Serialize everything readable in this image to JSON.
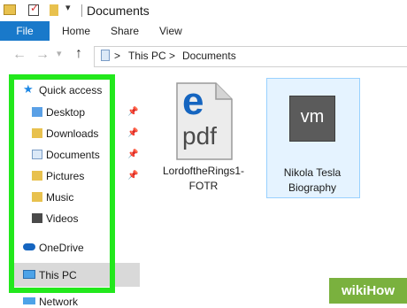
{
  "window": {
    "title": "Documents"
  },
  "ribbon": {
    "tabs": [
      "File",
      "Home",
      "Share",
      "View"
    ]
  },
  "address": {
    "segments": [
      "This PC",
      "Documents"
    ],
    "separator": ">"
  },
  "sidebar": {
    "quick_access": "Quick access",
    "items": [
      {
        "label": "Desktop",
        "pinned": true
      },
      {
        "label": "Downloads",
        "pinned": true
      },
      {
        "label": "Documents",
        "pinned": true
      },
      {
        "label": "Pictures",
        "pinned": true
      },
      {
        "label": "Music",
        "pinned": false
      },
      {
        "label": "Videos",
        "pinned": false
      }
    ],
    "onedrive": "OneDrive",
    "this_pc": "This PC",
    "network": "Network"
  },
  "files": [
    {
      "name_line1": "LordoftheRings1-",
      "name_line2": "FOTR",
      "icon_letter": "e",
      "icon_text": "pdf"
    },
    {
      "name_line1": "Nikola Tesla",
      "name_line2": "Biography",
      "icon_text": "vm"
    }
  ],
  "watermark": {
    "text": "wikiHow"
  },
  "colors": {
    "file_tab": "#1979ca",
    "highlight": "#22e81c",
    "selection": "#e5f3ff",
    "edge_blue": "#1565c0"
  }
}
